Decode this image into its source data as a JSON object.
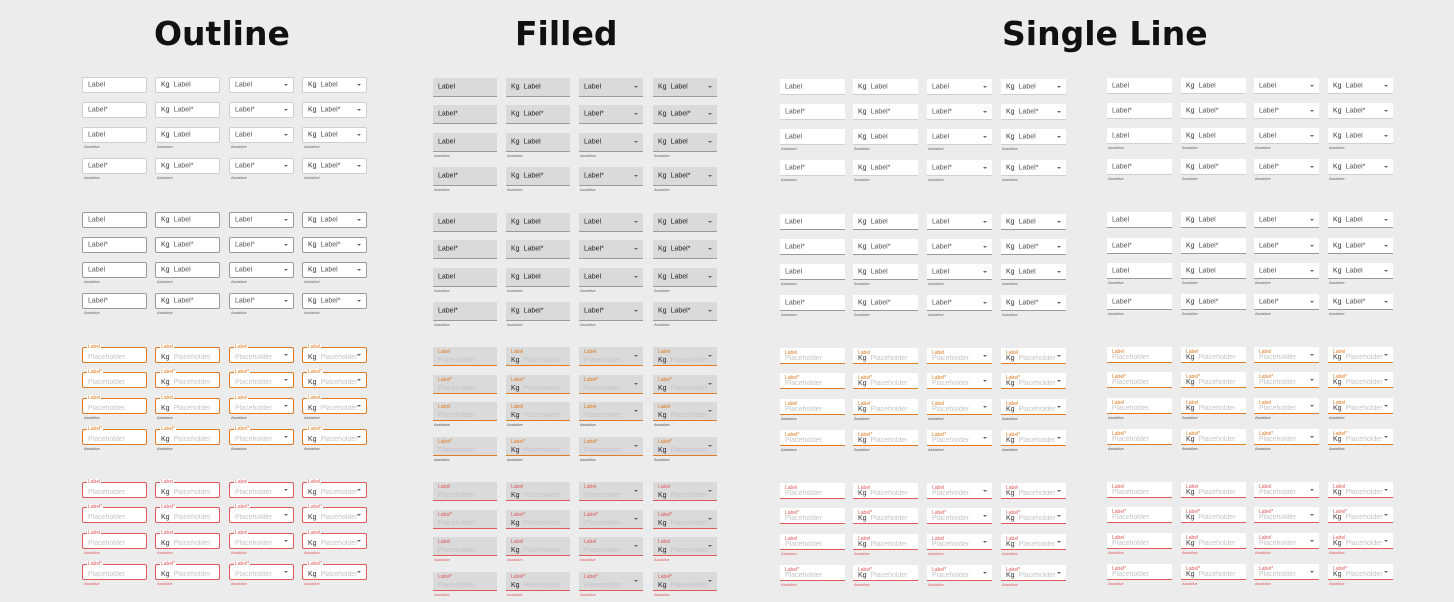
{
  "sections": [
    {
      "id": "outline",
      "title": "Outline"
    },
    {
      "id": "filled",
      "title": "Filled"
    },
    {
      "id": "single",
      "title": "Single Line"
    }
  ],
  "field_text": {
    "label": "Label",
    "label_required": "Label*",
    "placeholder": "Placeholder",
    "prefix": "Kg",
    "helper": "Assistive"
  },
  "icons": {
    "dropdown": "caret-down-icon"
  },
  "colors": {
    "background": "#ececec",
    "border_idle": "#cfcfcf",
    "border_default": "#9a9a9a",
    "focus": "#e07b24",
    "error": "#e05a5a",
    "filled_bg": "#dadada",
    "placeholder": "#c4c4c4"
  },
  "variants": [
    {
      "prefix": false,
      "dropdown": false
    },
    {
      "prefix": true,
      "dropdown": false
    },
    {
      "prefix": false,
      "dropdown": true
    },
    {
      "prefix": true,
      "dropdown": true
    }
  ],
  "rows": [
    {
      "required": false,
      "helper": false
    },
    {
      "required": true,
      "helper": false
    },
    {
      "required": false,
      "helper": true
    },
    {
      "required": true,
      "helper": true
    }
  ],
  "states": [
    "idle",
    "default",
    "focus",
    "error"
  ]
}
